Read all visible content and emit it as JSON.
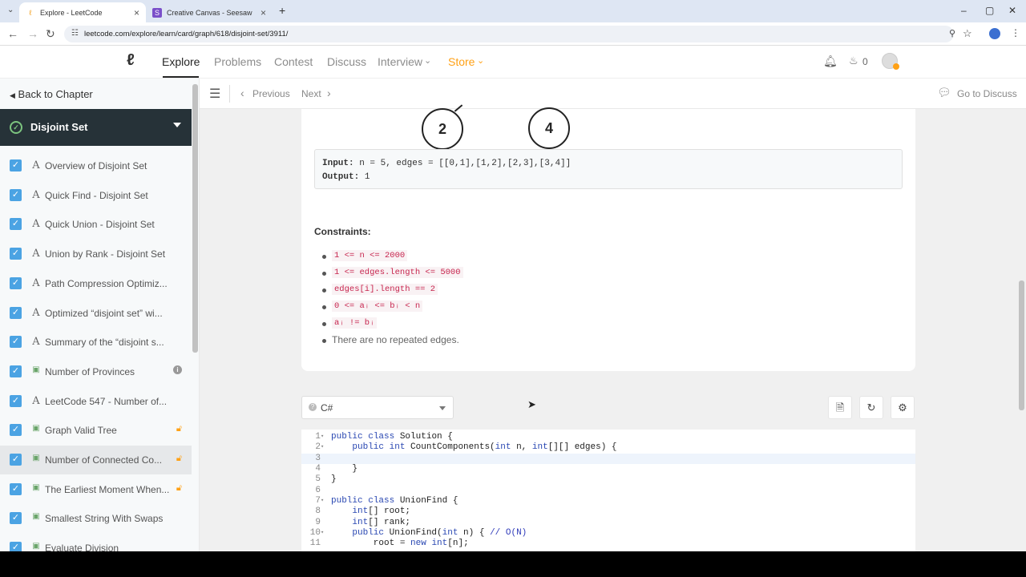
{
  "browser": {
    "tabs": [
      {
        "title": "Explore - LeetCode",
        "active": true
      },
      {
        "title": "Creative Canvas - Seesaw",
        "active": false
      }
    ],
    "new_tab": "+",
    "url": "leetcode.com/explore/learn/card/graph/618/disjoint-set/3911/"
  },
  "nav": {
    "items": [
      "Explore",
      "Problems",
      "Contest",
      "Discuss",
      "Interview",
      "Store"
    ],
    "fire_count": "0"
  },
  "sidebar": {
    "back_label": "Back to Chapter",
    "chapter_title": "Disjoint Set",
    "items": [
      {
        "label": "Overview of Disjoint Set",
        "type": "article"
      },
      {
        "label": "Quick Find - Disjoint Set",
        "type": "article"
      },
      {
        "label": "Quick Union - Disjoint Set",
        "type": "article"
      },
      {
        "label": "Union by Rank - Disjoint Set",
        "type": "article"
      },
      {
        "label": "Path Compression Optimiz...",
        "type": "article"
      },
      {
        "label": "Optimized “disjoint set” wi...",
        "type": "article"
      },
      {
        "label": "Summary of the “disjoint s...",
        "type": "article"
      },
      {
        "label": "Number of Provinces",
        "type": "problem",
        "badge": "info"
      },
      {
        "label": "LeetCode 547 - Number of...",
        "type": "article"
      },
      {
        "label": "Graph Valid Tree",
        "type": "problem",
        "badge": "lock"
      },
      {
        "label": "Number of Connected Co...",
        "type": "problem",
        "badge": "lock"
      },
      {
        "label": "The Earliest Moment When...",
        "type": "problem",
        "badge": "lock"
      },
      {
        "label": "Smallest String With Swaps",
        "type": "problem"
      },
      {
        "label": "Evaluate Division",
        "type": "problem"
      }
    ]
  },
  "toolbar": {
    "previous": "Previous",
    "next": "Next",
    "discuss": "Go to Discuss"
  },
  "content": {
    "nodes": [
      "2",
      "4"
    ],
    "example": {
      "input_label": "Input:",
      "input_value": " n = 5, edges = [[0,1],[1,2],[2,3],[3,4]]",
      "output_label": "Output:",
      "output_value": " 1"
    },
    "constraints_title": "Constraints:",
    "constraints": [
      "1 <= n <= 2000",
      "1 <= edges.length <= 5000",
      "edges[i].length == 2",
      "0 <= aᵢ <= bᵢ < n",
      "aᵢ != bᵢ"
    ],
    "constraints_plain": "There are no repeated edges."
  },
  "editor": {
    "language": "C#",
    "lines": [
      {
        "n": "1",
        "fold": true,
        "code": "public class Solution {"
      },
      {
        "n": "2",
        "fold": true,
        "code": "    public int CountComponents(int n, int[][] edges) {"
      },
      {
        "n": "3",
        "fold": false,
        "code": ""
      },
      {
        "n": "4",
        "fold": false,
        "code": "    }"
      },
      {
        "n": "5",
        "fold": false,
        "code": "}"
      },
      {
        "n": "6",
        "fold": false,
        "code": ""
      },
      {
        "n": "7",
        "fold": true,
        "code": "public class UnionFind {"
      },
      {
        "n": "8",
        "fold": false,
        "code": "    int[] root;"
      },
      {
        "n": "9",
        "fold": false,
        "code": "    int[] rank;"
      },
      {
        "n": "10",
        "fold": true,
        "code": "    public UnionFind(int n) { // O(N)"
      },
      {
        "n": "11",
        "fold": false,
        "code": "        root = new int[n];"
      }
    ]
  },
  "colors": {
    "accent": "#ffa116",
    "check": "#4ba3e3",
    "chapter_bg": "#263238"
  }
}
